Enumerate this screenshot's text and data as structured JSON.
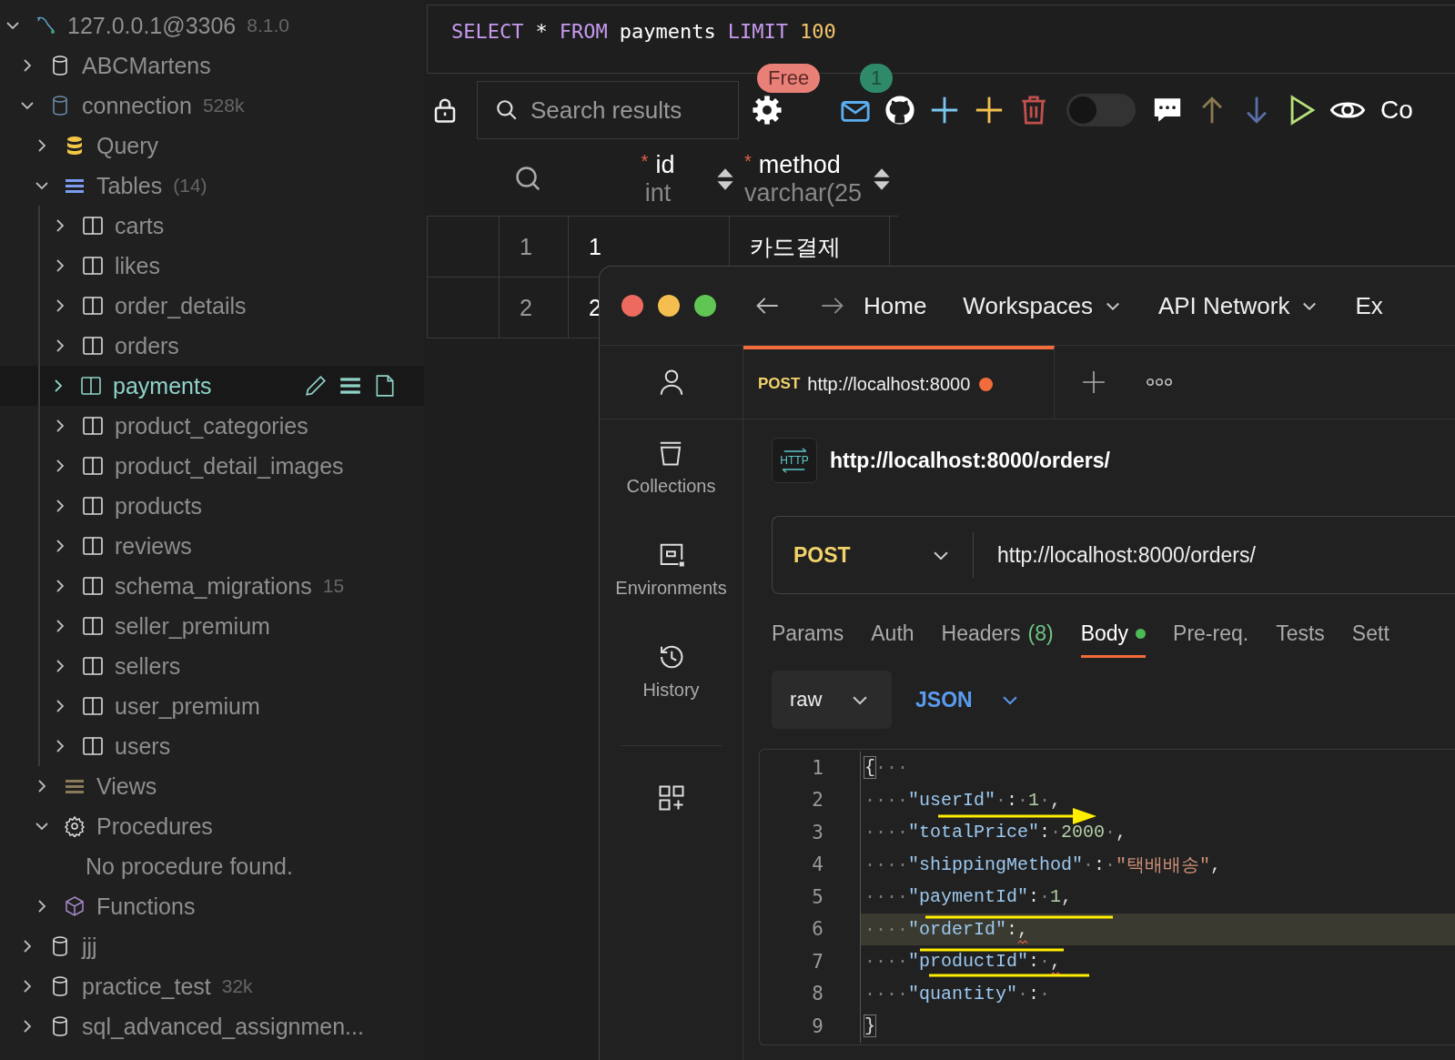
{
  "sidebar": {
    "tree": [
      {
        "kind": "connection",
        "label": "127.0.0.1@3306",
        "meta": "8.1.0",
        "expanded": true,
        "children": [
          {
            "kind": "database",
            "label": "ABCMartens",
            "expanded": false
          },
          {
            "kind": "database",
            "label": "connection",
            "meta": "528k",
            "expanded": true,
            "children": [
              {
                "kind": "query",
                "label": "Query",
                "expanded": false
              },
              {
                "kind": "tables",
                "label": "Tables",
                "meta": "(14)",
                "expanded": true,
                "children": [
                  {
                    "kind": "table",
                    "label": "carts",
                    "selected": false
                  },
                  {
                    "kind": "table",
                    "label": "likes",
                    "selected": false
                  },
                  {
                    "kind": "table",
                    "label": "order_details",
                    "selected": false
                  },
                  {
                    "kind": "table",
                    "label": "orders",
                    "selected": false
                  },
                  {
                    "kind": "table",
                    "label": "payments",
                    "selected": true
                  },
                  {
                    "kind": "table",
                    "label": "product_categories",
                    "selected": false
                  },
                  {
                    "kind": "table",
                    "label": "product_detail_images",
                    "selected": false
                  },
                  {
                    "kind": "table",
                    "label": "products",
                    "selected": false
                  },
                  {
                    "kind": "table",
                    "label": "reviews",
                    "selected": false
                  },
                  {
                    "kind": "table",
                    "label": "schema_migrations",
                    "meta": "15",
                    "selected": false
                  },
                  {
                    "kind": "table",
                    "label": "seller_premium",
                    "selected": false
                  },
                  {
                    "kind": "table",
                    "label": "sellers",
                    "selected": false
                  },
                  {
                    "kind": "table",
                    "label": "user_premium",
                    "selected": false
                  },
                  {
                    "kind": "table",
                    "label": "users",
                    "selected": false
                  }
                ]
              },
              {
                "kind": "views",
                "label": "Views",
                "expanded": false
              },
              {
                "kind": "procedures",
                "label": "Procedures",
                "expanded": true,
                "children": [
                  {
                    "kind": "note",
                    "label": "No procedure found."
                  }
                ]
              },
              {
                "kind": "functions",
                "label": "Functions",
                "expanded": false
              }
            ]
          },
          {
            "kind": "database",
            "label": "jjj",
            "expanded": false
          },
          {
            "kind": "database",
            "label": "practice_test",
            "meta": "32k",
            "expanded": false
          },
          {
            "kind": "database",
            "label": "sql_advanced_assignmen...",
            "expanded": false
          }
        ]
      }
    ]
  },
  "query": {
    "tokens": [
      {
        "kind": "keyword",
        "text": "SELECT"
      },
      {
        "kind": "plain",
        "text": "*"
      },
      {
        "kind": "keyword",
        "text": "FROM"
      },
      {
        "kind": "plain",
        "text": "payments"
      },
      {
        "kind": "keyword",
        "text": "LIMIT"
      },
      {
        "kind": "number",
        "text": "100"
      }
    ]
  },
  "toolbar": {
    "search": {
      "placeholder": "Search results"
    },
    "settings_badge": "Free",
    "mail_badge": "1",
    "toggle_on": false,
    "cut_label": "Co"
  },
  "grid": {
    "columns": [
      {
        "name": "id",
        "type": "int",
        "required": true
      },
      {
        "name": "method",
        "type": "varchar(25",
        "required": true
      }
    ],
    "rows": [
      {
        "number": "1",
        "cells": [
          "1",
          "카드결제"
        ]
      },
      {
        "number": "2",
        "cells": [
          "2"
        ]
      }
    ]
  },
  "postman": {
    "nav": [
      {
        "label": "Home",
        "dropdown": false
      },
      {
        "label": "Workspaces",
        "dropdown": true
      },
      {
        "label": "API Network",
        "dropdown": true
      },
      {
        "label": "Ex",
        "dropdown": false
      }
    ],
    "rail": [
      {
        "kind": "account"
      },
      {
        "kind": "collections",
        "label": "Collections"
      },
      {
        "kind": "environments",
        "label": "Environments"
      },
      {
        "kind": "history",
        "label": "History"
      },
      {
        "kind": "apps"
      }
    ],
    "tab": {
      "method": "POST",
      "title": "http://localhost:8000",
      "unsaved": true
    },
    "request": {
      "icon_text": "HTTP",
      "title": "http://localhost:8000/orders/",
      "method": "POST",
      "url": "http://localhost:8000/orders/"
    },
    "request_tabs": [
      {
        "label": "Params",
        "selected": false
      },
      {
        "label": "Auth",
        "selected": false
      },
      {
        "label": "Headers",
        "count": "(8)",
        "selected": false
      },
      {
        "label": "Body",
        "dot": true,
        "selected": true
      },
      {
        "label": "Pre-req.",
        "selected": false
      },
      {
        "label": "Tests",
        "selected": false
      },
      {
        "label": "Sett",
        "selected": false
      }
    ],
    "body_mode": "raw",
    "body_language": "JSON",
    "code": [
      {
        "number": "1",
        "current": false,
        "tokens": [
          {
            "kind": "brace",
            "text": "{"
          },
          {
            "kind": "ws",
            "text": "···"
          }
        ]
      },
      {
        "number": "2",
        "current": false,
        "tokens": [
          {
            "kind": "ws",
            "text": "····"
          },
          {
            "kind": "key",
            "text": "\"userId\""
          },
          {
            "kind": "ws",
            "text": "·"
          },
          {
            "kind": "punct",
            "text": ":"
          },
          {
            "kind": "ws",
            "text": "·"
          },
          {
            "kind": "number",
            "text": "1"
          },
          {
            "kind": "ws",
            "text": "·"
          },
          {
            "kind": "punct",
            "text": ","
          }
        ]
      },
      {
        "number": "3",
        "current": false,
        "tokens": [
          {
            "kind": "ws",
            "text": "····"
          },
          {
            "kind": "key",
            "text": "\"totalPrice\""
          },
          {
            "kind": "punct",
            "text": ":"
          },
          {
            "kind": "ws",
            "text": "·"
          },
          {
            "kind": "number",
            "text": "2000"
          },
          {
            "kind": "ws",
            "text": "·"
          },
          {
            "kind": "punct",
            "text": ","
          }
        ]
      },
      {
        "number": "4",
        "current": false,
        "tokens": [
          {
            "kind": "ws",
            "text": "····"
          },
          {
            "kind": "key",
            "text": "\"shippingMethod\""
          },
          {
            "kind": "ws",
            "text": "·"
          },
          {
            "kind": "punct",
            "text": ":"
          },
          {
            "kind": "ws",
            "text": "·"
          },
          {
            "kind": "string",
            "text": "\"택배배송\""
          },
          {
            "kind": "punct",
            "text": ","
          }
        ]
      },
      {
        "number": "5",
        "current": false,
        "tokens": [
          {
            "kind": "ws",
            "text": "····"
          },
          {
            "kind": "key",
            "text": "\"paymentId\""
          },
          {
            "kind": "punct",
            "text": ":"
          },
          {
            "kind": "ws",
            "text": "·"
          },
          {
            "kind": "number",
            "text": "1"
          },
          {
            "kind": "punct",
            "text": ","
          }
        ]
      },
      {
        "number": "6",
        "current": true,
        "tokens": [
          {
            "kind": "ws",
            "text": "····"
          },
          {
            "kind": "key",
            "text": "\"orderId\""
          },
          {
            "kind": "punct",
            "text": ":"
          },
          {
            "kind": "punct",
            "text": ",",
            "error": true
          }
        ]
      },
      {
        "number": "7",
        "current": false,
        "tokens": [
          {
            "kind": "ws",
            "text": "····"
          },
          {
            "kind": "key",
            "text": "\"productId\""
          },
          {
            "kind": "punct",
            "text": ":"
          },
          {
            "kind": "ws",
            "text": "·"
          },
          {
            "kind": "punct",
            "text": ",",
            "error": true
          }
        ]
      },
      {
        "number": "8",
        "current": false,
        "tokens": [
          {
            "kind": "ws",
            "text": "····"
          },
          {
            "kind": "key",
            "text": "\"quantity\""
          },
          {
            "kind": "ws",
            "text": "·"
          },
          {
            "kind": "punct",
            "text": ":"
          },
          {
            "kind": "ws",
            "text": "·"
          }
        ]
      },
      {
        "number": "9",
        "current": false,
        "tokens": [
          {
            "kind": "brace",
            "text": "}"
          }
        ]
      }
    ]
  }
}
